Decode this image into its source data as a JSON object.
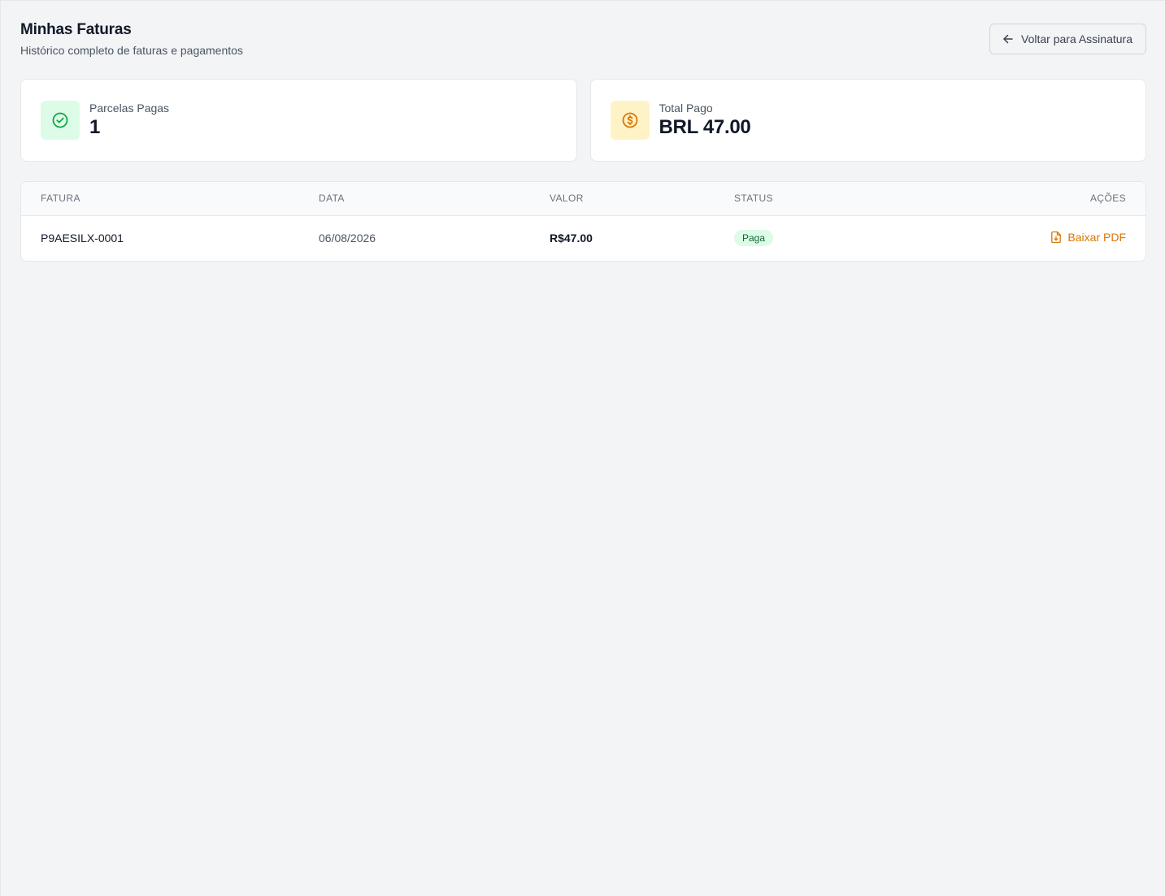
{
  "header": {
    "title": "Minhas Faturas",
    "subtitle": "Histórico completo de faturas e pagamentos",
    "back_button_label": "Voltar para Assinatura"
  },
  "stats": [
    {
      "label": "Parcelas Pagas",
      "value": "1",
      "icon": "check-circle-icon",
      "color": "#16a34a"
    },
    {
      "label": "Total Pago",
      "value": "BRL 47.00",
      "icon": "dollar-circle-icon",
      "color": "#d97706"
    }
  ],
  "table": {
    "columns": [
      "FATURA",
      "DATA",
      "VALOR",
      "STATUS",
      "AÇÕES"
    ],
    "rows": [
      {
        "invoice": "P9AESILX-0001",
        "date": "06/08/2026",
        "amount": "R$47.00",
        "status": "Paga",
        "action": "Baixar PDF"
      }
    ]
  },
  "colors": {
    "background": "#f3f4f6",
    "accent": "#d97706",
    "success": "#16a34a"
  }
}
